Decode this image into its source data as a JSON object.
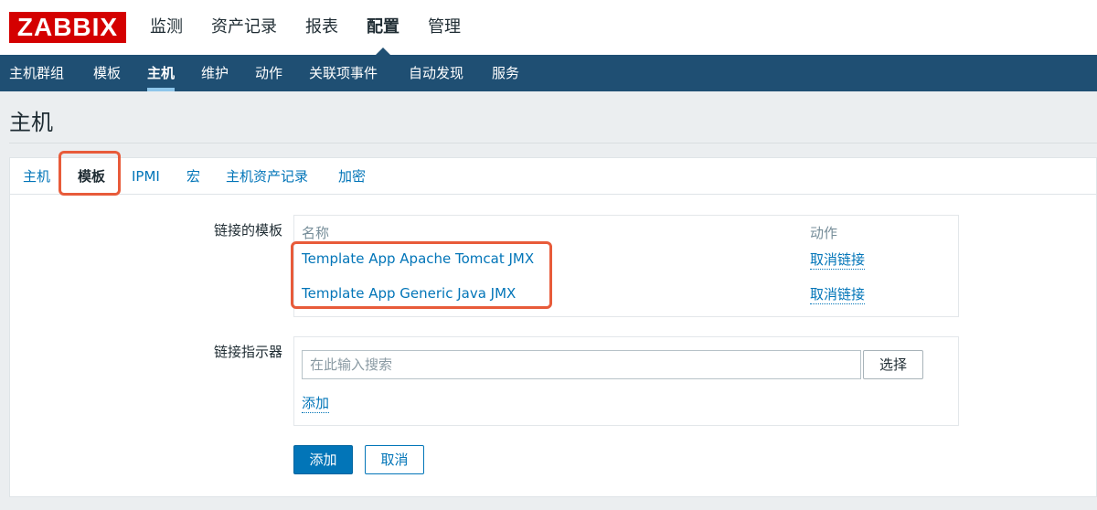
{
  "brand": {
    "logo_text": "ZABBIX",
    "accent": "#d40000"
  },
  "top_menu": [
    {
      "label": "监测",
      "active": false
    },
    {
      "label": "资产记录",
      "active": false
    },
    {
      "label": "报表",
      "active": false
    },
    {
      "label": "配置",
      "active": true
    },
    {
      "label": "管理",
      "active": false
    }
  ],
  "sub_nav": [
    {
      "label": "主机群组",
      "active": false
    },
    {
      "label": "模板",
      "active": false
    },
    {
      "label": "主机",
      "active": true
    },
    {
      "label": "维护",
      "active": false
    },
    {
      "label": "动作",
      "active": false
    },
    {
      "label": "关联项事件",
      "active": false
    },
    {
      "label": "自动发现",
      "active": false
    },
    {
      "label": "服务",
      "active": false
    }
  ],
  "page": {
    "title": "主机"
  },
  "tabs": [
    {
      "label": "主机",
      "active": false
    },
    {
      "label": "模板",
      "active": true
    },
    {
      "label": "IPMI",
      "active": false
    },
    {
      "label": "宏",
      "active": false
    },
    {
      "label": "主机资产记录",
      "active": false
    },
    {
      "label": "加密",
      "active": false
    }
  ],
  "linked_templates": {
    "label": "链接的模板",
    "col_name": "名称",
    "col_action": "动作",
    "rows": [
      {
        "name": "Template App Apache Tomcat JMX",
        "action": "取消链接"
      },
      {
        "name": "Template App Generic Java JMX",
        "action": "取消链接"
      }
    ]
  },
  "link_indicator": {
    "label": "链接指示器",
    "search_placeholder": "在此输入搜索",
    "select_label": "选择",
    "add_label": "添加"
  },
  "form_buttons": {
    "add": "添加",
    "cancel": "取消"
  },
  "colors": {
    "nav_bg": "#1f4f73",
    "link": "#0275b8",
    "highlight": "#e85b3a"
  }
}
